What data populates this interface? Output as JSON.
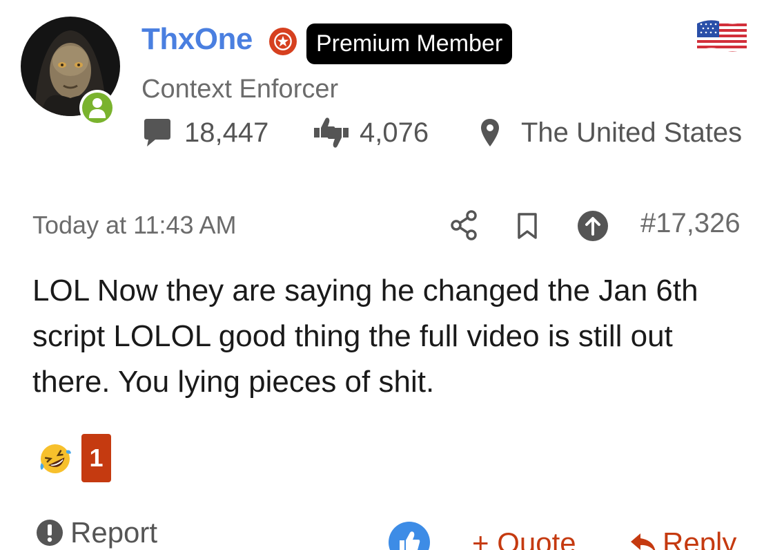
{
  "user": {
    "username": "ThxOne",
    "badge": "Premium Member",
    "title": "Context Enforcer",
    "online": true
  },
  "stats": {
    "messages": "18,447",
    "reactions": "4,076",
    "location": "The United States"
  },
  "post": {
    "timestamp": "Today at 11:43 AM",
    "number": "#17,326",
    "body": "LOL Now they are saying he changed the Jan 6th script LOLOL good thing the full video is still out there. You lying pieces of shit."
  },
  "reactions": [
    {
      "icon": "rofl-emoji-icon",
      "count": "1"
    }
  ],
  "footer": {
    "report": "Report",
    "quote": "+ Quote",
    "reply": "Reply"
  },
  "colors": {
    "username": "#4a7fe0",
    "accent": "#c53a10",
    "online": "#7ab32e",
    "like": "#3d8ce6",
    "muted": "#6b6b6b"
  },
  "icons": {
    "messages": "speech-bubble-icon",
    "reactions": "thumbs-up-down-icon",
    "location": "map-pin-icon",
    "share": "share-icon",
    "bookmark": "bookmark-icon",
    "jump": "arrow-up-circle-icon",
    "report": "exclamation-circle-icon",
    "like": "thumbs-up-icon",
    "reply": "reply-arrow-icon",
    "flag": "us-flag-icon"
  }
}
